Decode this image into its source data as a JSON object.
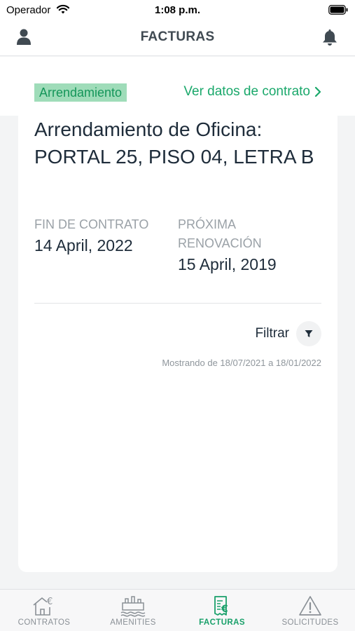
{
  "status_bar": {
    "carrier": "Operador",
    "time": "1:08 p.m."
  },
  "header": {
    "title": "FACTURAS",
    "left_icon": "user-icon",
    "right_icon": "bell-icon"
  },
  "contract": {
    "tag": "Arrendamiento",
    "view_link": "Ver datos de contrato",
    "title": "Arrendamiento de Oficina: PORTAL 25, PISO 04, LETRA B",
    "end_label": "FIN DE CONTRATO",
    "end_value": "14 April, 2022",
    "renewal_label": "PRÓXIMA RENOVACIÓN",
    "renewal_value": "15 April, 2019"
  },
  "filter": {
    "label": "Filtrar",
    "icon": "filter-icon",
    "range_text": "Mostrando de 18/07/2021 a 18/01/2022"
  },
  "tabs": [
    {
      "label": "CONTRATOS",
      "icon": "house-euro-icon",
      "active": false
    },
    {
      "label": "AMENITIES",
      "icon": "amenities-icon",
      "active": false
    },
    {
      "label": "FACTURAS",
      "icon": "invoice-euro-icon",
      "active": true
    },
    {
      "label": "SOLICITUDES",
      "icon": "warning-icon",
      "active": false
    }
  ],
  "colors": {
    "accent": "#1aa86b",
    "tag_bg": "#9fdcb9",
    "text_dark": "#1e2c3a",
    "text_muted": "#9aa1a7"
  }
}
